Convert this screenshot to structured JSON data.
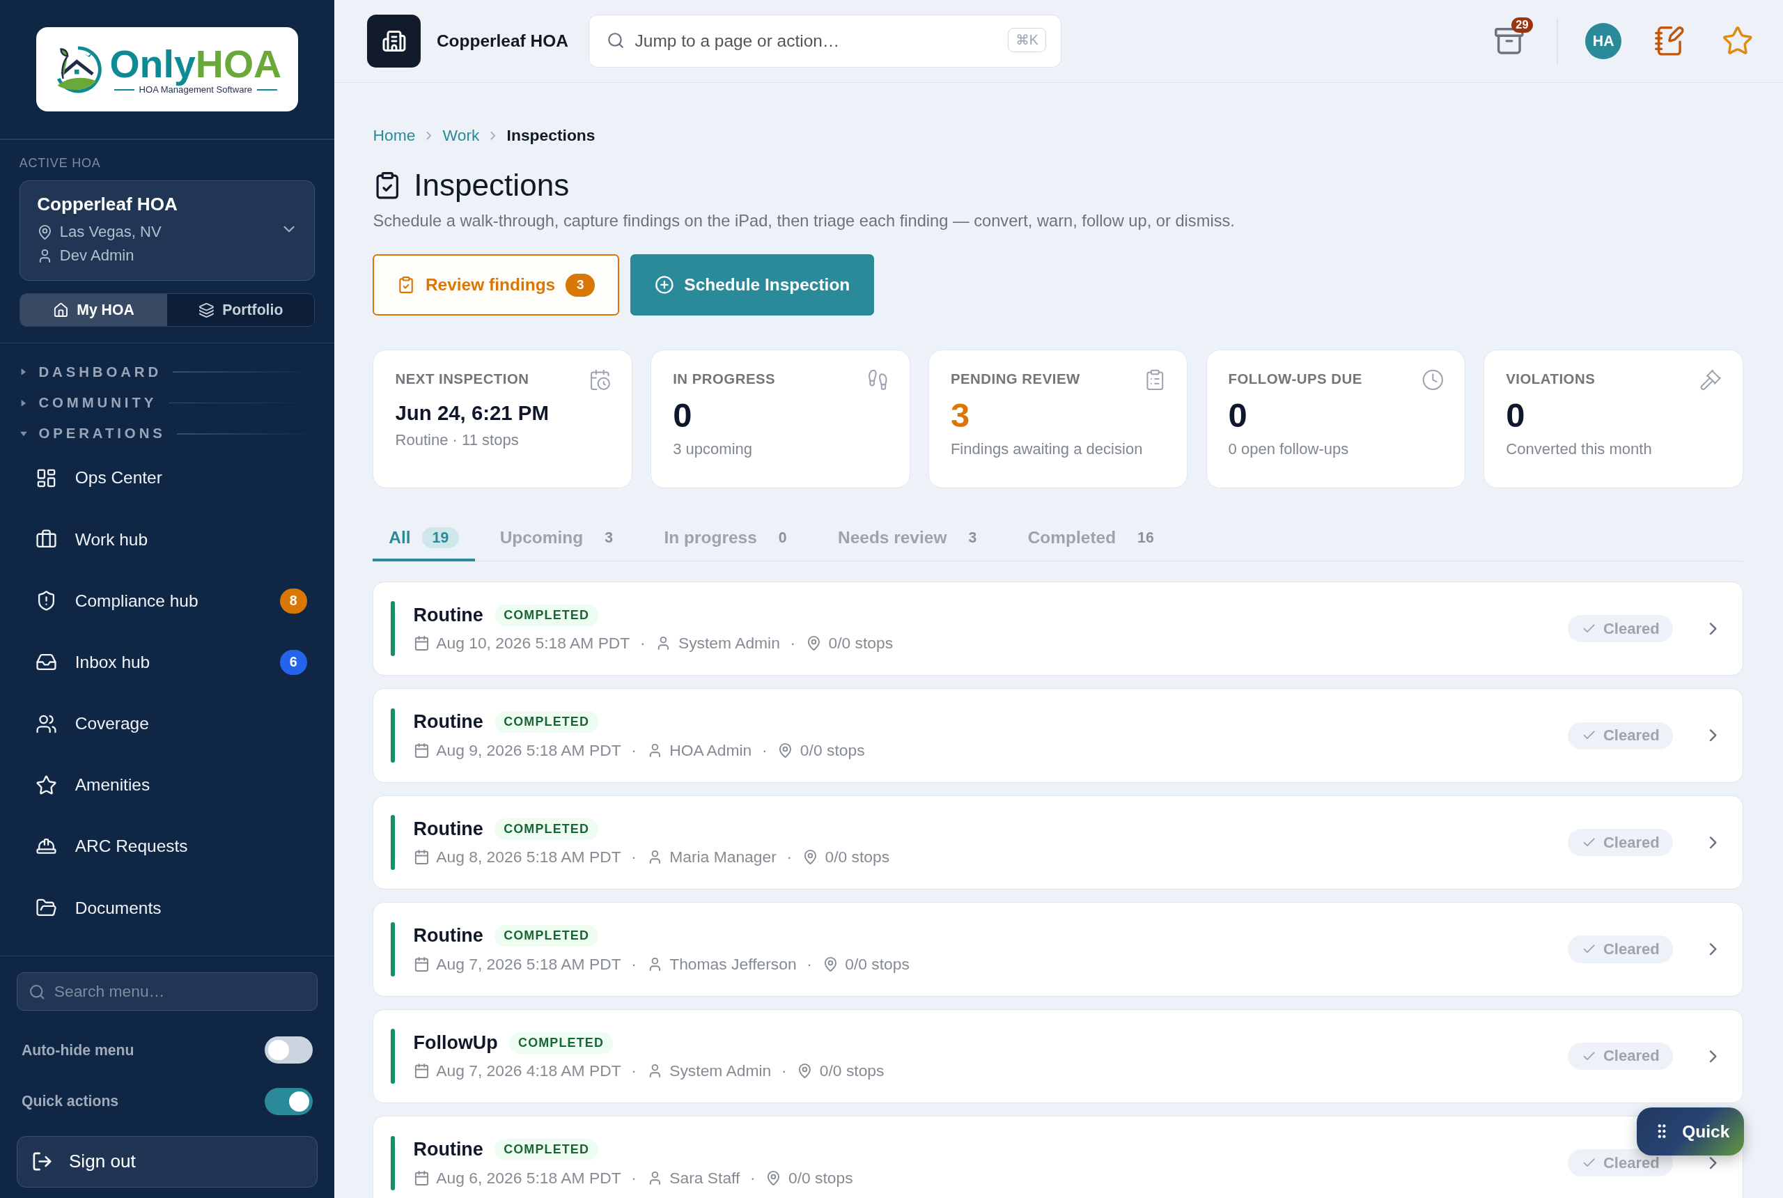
{
  "logo": {
    "word_1": "Only",
    "word_2": "HOA",
    "tagline": "HOA Management Software"
  },
  "active_hoa": {
    "label": "ACTIVE HOA",
    "name": "Copperleaf HOA",
    "location": "Las Vegas, NV",
    "user": "Dev Admin"
  },
  "scope_tabs": [
    {
      "label": "My HOA",
      "selected": true
    },
    {
      "label": "Portfolio",
      "selected": false
    }
  ],
  "nav_sections": [
    {
      "label": "DASHBOARD",
      "expanded": false
    },
    {
      "label": "COMMUNITY",
      "expanded": false
    },
    {
      "label": "OPERATIONS",
      "expanded": true,
      "items": [
        {
          "label": "Ops Center"
        },
        {
          "label": "Work hub"
        },
        {
          "label": "Compliance hub",
          "badge": "8",
          "color": "#d97706"
        },
        {
          "label": "Inbox hub",
          "badge": "6",
          "color": "#2563eb"
        },
        {
          "label": "Coverage"
        },
        {
          "label": "Amenities"
        },
        {
          "label": "ARC Requests"
        },
        {
          "label": "Documents"
        }
      ]
    }
  ],
  "menu_search": {
    "placeholder": "Search menu…"
  },
  "toggles": [
    {
      "label": "Auto-hide menu",
      "on": false
    },
    {
      "label": "Quick actions",
      "on": true
    }
  ],
  "sign_out": "Sign out",
  "topbar": {
    "org": "Copperleaf HOA",
    "search_placeholder": "Jump to a page or action…",
    "shortcut": "⌘K",
    "notifications": "29",
    "avatar": "HA"
  },
  "breadcrumb": [
    {
      "label": "Home",
      "current": false
    },
    {
      "label": "Work",
      "current": false
    },
    {
      "label": "Inspections",
      "current": true
    }
  ],
  "page": {
    "title": "Inspections",
    "description": "Schedule a walk-through, capture findings on the iPad, then triage each finding — convert, warn, follow up, or dismiss."
  },
  "actions": [
    {
      "kind": "outline",
      "label": "Review findings",
      "count": "3"
    },
    {
      "kind": "primary",
      "label": "Schedule Inspection"
    }
  ],
  "stats": [
    {
      "label": "NEXT INSPECTION",
      "value": "Jun 24, 6:21 PM",
      "sub": "Routine · 11 stops",
      "kind": "date",
      "accent": false
    },
    {
      "label": "IN PROGRESS",
      "value": "0",
      "sub": "3 upcoming",
      "kind": "number",
      "accent": false
    },
    {
      "label": "PENDING REVIEW",
      "value": "3",
      "sub": "Findings awaiting a decision",
      "kind": "number",
      "accent": true
    },
    {
      "label": "FOLLOW-UPS DUE",
      "value": "0",
      "sub": "0 open follow-ups",
      "kind": "number",
      "accent": false
    },
    {
      "label": "VIOLATIONS",
      "value": "0",
      "sub": "Converted this month",
      "kind": "number",
      "accent": false
    }
  ],
  "filter_tabs": [
    {
      "label": "All",
      "count": "19",
      "selected": true
    },
    {
      "label": "Upcoming",
      "count": "3",
      "selected": false
    },
    {
      "label": "In progress",
      "count": "0",
      "selected": false
    },
    {
      "label": "Needs review",
      "count": "3",
      "selected": false
    },
    {
      "label": "Completed",
      "count": "16",
      "selected": false
    }
  ],
  "inspections": [
    {
      "title": "Routine",
      "status": "COMPLETED",
      "date": "Aug 10, 2026 5:18 AM PDT",
      "person": "System Admin",
      "stops": "0/0 stops",
      "result": "Cleared"
    },
    {
      "title": "Routine",
      "status": "COMPLETED",
      "date": "Aug 9, 2026 5:18 AM PDT",
      "person": "HOA Admin",
      "stops": "0/0 stops",
      "result": "Cleared"
    },
    {
      "title": "Routine",
      "status": "COMPLETED",
      "date": "Aug 8, 2026 5:18 AM PDT",
      "person": "Maria Manager",
      "stops": "0/0 stops",
      "result": "Cleared"
    },
    {
      "title": "Routine",
      "status": "COMPLETED",
      "date": "Aug 7, 2026 5:18 AM PDT",
      "person": "Thomas Jefferson",
      "stops": "0/0 stops",
      "result": "Cleared"
    },
    {
      "title": "FollowUp",
      "status": "COMPLETED",
      "date": "Aug 7, 2026 4:18 AM PDT",
      "person": "System Admin",
      "stops": "0/0 stops",
      "result": "Cleared"
    },
    {
      "title": "Routine",
      "status": "COMPLETED",
      "date": "Aug 6, 2026 5:18 AM PDT",
      "person": "Sara Staff",
      "stops": "0/0 stops",
      "result": "Cleared"
    }
  ],
  "meta_separator": "·",
  "quick_button": "Quick"
}
